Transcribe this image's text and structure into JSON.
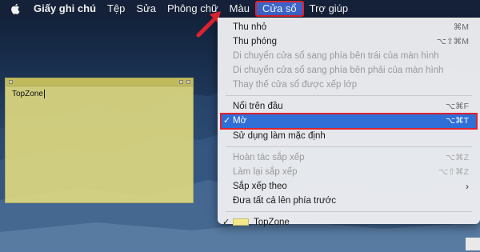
{
  "menubar": {
    "app_name": "Giấy ghi chú",
    "items": [
      "Tệp",
      "Sửa",
      "Phông chữ",
      "Màu",
      "Cửa sổ",
      "Trợ giúp"
    ]
  },
  "sticky_note": {
    "text": "TopZone"
  },
  "window_menu": {
    "items": [
      {
        "label": "Thu nhỏ",
        "shortcut": "⌘M",
        "disabled": false
      },
      {
        "label": "Thu phóng",
        "shortcut": "⌥⇧⌘M",
        "disabled": false
      },
      {
        "label": "Di chuyển cửa sổ sang phía bên trái của màn hình",
        "shortcut": "",
        "disabled": true
      },
      {
        "label": "Di chuyển cửa sổ sang phía bên phải của màn hình",
        "shortcut": "",
        "disabled": true
      },
      {
        "label": "Thay thế cửa sổ được xếp lớp",
        "shortcut": "",
        "disabled": true
      },
      {
        "label": "Nổi trên đầu",
        "shortcut": "⌥⌘F",
        "disabled": false
      },
      {
        "label": "Mờ",
        "shortcut": "⌥⌘T",
        "disabled": false,
        "checked": true,
        "selected": true
      },
      {
        "label": "Sử dụng làm mặc định",
        "shortcut": "",
        "disabled": false
      },
      {
        "label": "Hoàn tác sắp xếp",
        "shortcut": "⌥⌘Z",
        "disabled": true
      },
      {
        "label": "Làm lại sắp xếp",
        "shortcut": "⌥⇧⌘Z",
        "disabled": true
      },
      {
        "label": "Sắp xếp theo",
        "shortcut": "",
        "disabled": false,
        "submenu": true
      },
      {
        "label": "Đưa tất cả lên phía trước",
        "shortcut": "",
        "disabled": false
      },
      {
        "label": "TopZone",
        "shortcut": "",
        "disabled": false,
        "checked": true,
        "swatch_color": "#f2ea8a"
      }
    ]
  },
  "colors": {
    "highlight": "#2f6fd6",
    "annotation_red": "#e0222f",
    "sticky_yellow": "#ddd880"
  }
}
